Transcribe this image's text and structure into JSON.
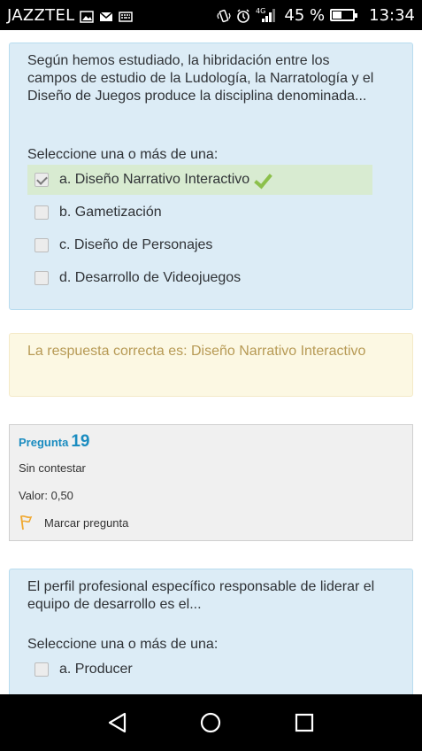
{
  "statusbar": {
    "carrier": "JAZZTEL",
    "network": "4G",
    "battery_text": "45 %",
    "battery_level": 0.45,
    "time": "13:34"
  },
  "question18": {
    "text": "Según hemos estudiado, la hibridación entre los campos de estudio de la Ludología, la Narratología y el Diseño de Juegos produce la disciplina denominada...",
    "prompt": "Seleccione una o más de una:",
    "options": [
      {
        "label": "a. Diseño Narrativo Interactivo",
        "checked": true,
        "correct": true
      },
      {
        "label": "b. Gametización",
        "checked": false,
        "correct": false
      },
      {
        "label": "c. Diseño de Personajes",
        "checked": false,
        "correct": false
      },
      {
        "label": "d. Desarrollo de Videojuegos",
        "checked": false,
        "correct": false
      }
    ]
  },
  "feedback": {
    "text": "La respuesta correcta es: Diseño Narrativo Interactivo"
  },
  "question19_info": {
    "label": "Pregunta",
    "number": "19",
    "state": "Sin contestar",
    "mark": "Valor: 0,50",
    "flag_label": "Marcar pregunta"
  },
  "question19": {
    "text": "El perfil profesional específico responsable de liderar el equipo de desarrollo es el...",
    "prompt": "Seleccione una o más de una:",
    "options": [
      {
        "label": "a. Producer",
        "checked": false
      }
    ]
  },
  "colors": {
    "question_bg": "#dcecf6",
    "correct_bg": "#d8ebd1",
    "feedback_bg": "#fcf8e3",
    "feedback_text": "#b79a55",
    "qno_color": "#1a8cc0",
    "tick_color": "#8cc04b",
    "flag_color": "#f0a830"
  },
  "navbar": {
    "back": "back-icon",
    "home": "home-icon",
    "recents": "recents-icon"
  }
}
